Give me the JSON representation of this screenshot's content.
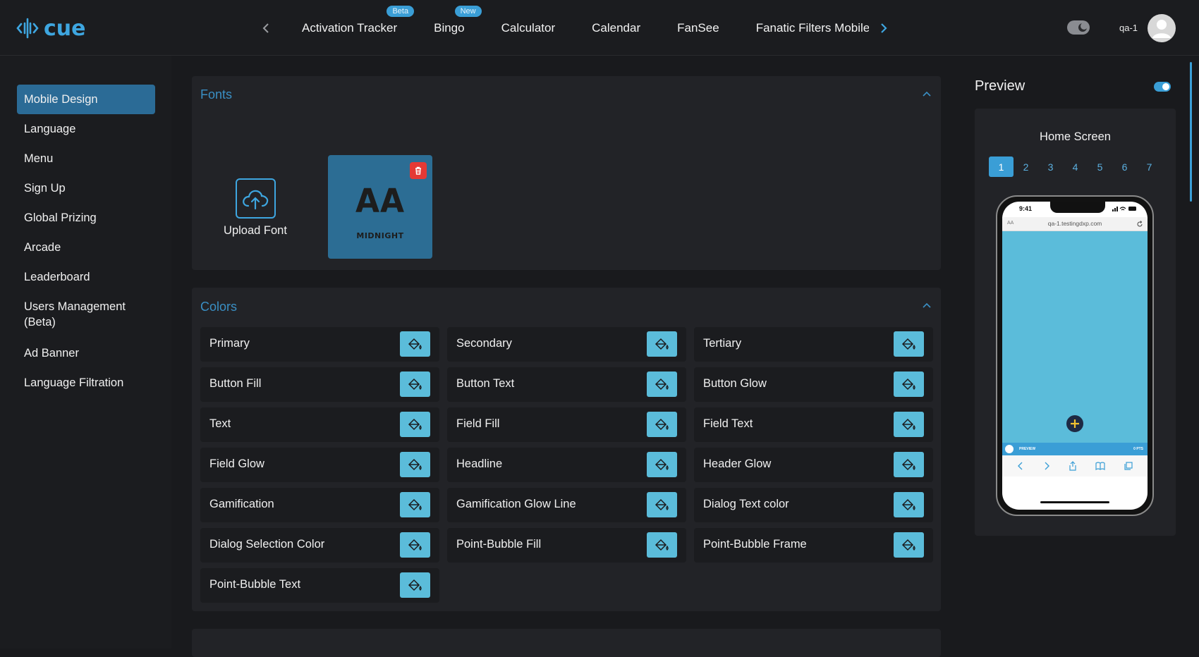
{
  "app": {
    "logo_text": "cue"
  },
  "nav": {
    "tabs": [
      {
        "label": "Activation Tracker",
        "badge": "Beta"
      },
      {
        "label": "Bingo",
        "badge": "New"
      },
      {
        "label": "Calculator",
        "badge": ""
      },
      {
        "label": "Calendar",
        "badge": ""
      },
      {
        "label": "FanSee",
        "badge": ""
      },
      {
        "label": "Fanatic Filters Mobile",
        "badge": ""
      }
    ],
    "prev_icon": "chevron-left-icon",
    "next_icon": "chevron-right-icon"
  },
  "user": {
    "name": "qa-1"
  },
  "sidebar": {
    "items": [
      {
        "label": "Mobile Design",
        "active": true
      },
      {
        "label": "Language"
      },
      {
        "label": "Menu"
      },
      {
        "label": "Sign Up"
      },
      {
        "label": "Global Prizing"
      },
      {
        "label": "Arcade"
      },
      {
        "label": "Leaderboard"
      },
      {
        "label": "Users Management (Beta)"
      },
      {
        "label": "Ad Banner"
      },
      {
        "label": "Language Filtration"
      }
    ]
  },
  "fonts": {
    "title": "Fonts",
    "upload_label": "Upload Font",
    "font_card": {
      "preview": "AA",
      "name": "MIDNIGHT"
    }
  },
  "colors": {
    "title": "Colors",
    "items": [
      "Primary",
      "Secondary",
      "Tertiary",
      "Button Fill",
      "Button Text",
      "Button Glow",
      "Text",
      "Field Fill",
      "Field Text",
      "Field Glow",
      "Headline",
      "Header Glow",
      "Gamification",
      "Gamification Glow Line",
      "Dialog Text color",
      "Dialog Selection Color",
      "Point-Bubble Fill",
      "Point-Bubble Frame",
      "Point-Bubble Text"
    ],
    "swatch_color": "#5bbcda"
  },
  "preview": {
    "title": "Preview",
    "screen_name": "Home Screen",
    "pages": [
      "1",
      "2",
      "3",
      "4",
      "5",
      "6",
      "7"
    ],
    "active_page": "1",
    "phone": {
      "time": "9:41",
      "url": "qa-1.testingdxp.com",
      "aa": "AA",
      "bottom_left": "PREVIEW",
      "bottom_right": "0 PTS"
    }
  },
  "theme": {
    "accent": "#3a9ed6",
    "background": "#191a1d"
  }
}
